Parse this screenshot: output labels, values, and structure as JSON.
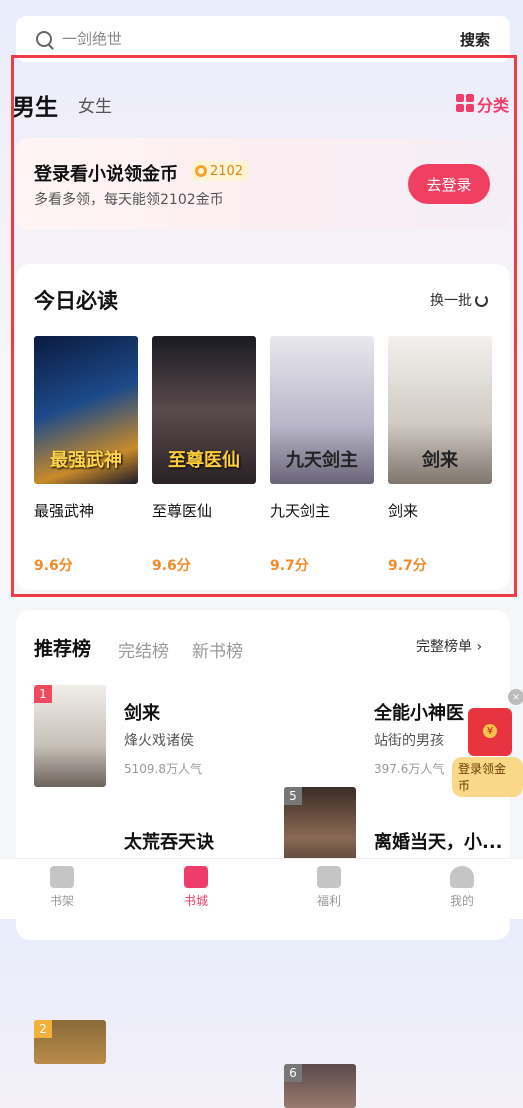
{
  "search": {
    "placeholder": "一剑绝世",
    "button": "搜索"
  },
  "gender_tabs": {
    "male": "男生",
    "female": "女生"
  },
  "category": {
    "label": "分类",
    "icon": "grid-icon",
    "color": "#ee3d6b"
  },
  "login_card": {
    "title": "登录看小说领金币",
    "coins": "2102",
    "subtitle": "多看多领，每天能领2102金币",
    "button": "去登录"
  },
  "today": {
    "title": "今日必读",
    "refresh": "换一批",
    "books": [
      {
        "name": "最强武神",
        "score": "9.6分",
        "cover_text": "最强武神"
      },
      {
        "name": "至尊医仙",
        "score": "9.6分",
        "cover_text": "至尊医仙"
      },
      {
        "name": "九天剑主",
        "score": "9.7分",
        "cover_text": "九天剑主"
      },
      {
        "name": "剑来",
        "score": "9.7分",
        "cover_text": "剑来"
      }
    ]
  },
  "ranking": {
    "tabs": [
      "推荐榜",
      "完结榜",
      "新书榜"
    ],
    "full_list": "完整榜单 ›",
    "items": [
      {
        "no": "1",
        "title": "剑来",
        "author": "烽火戏诸侯",
        "popularity": "5109.8万人气"
      },
      {
        "no": "5",
        "title": "全能小神医",
        "author": "站街的男孩",
        "popularity": "397.6万人气"
      },
      {
        "no": "2",
        "title": "太荒吞天诀",
        "author": "",
        "popularity": ""
      },
      {
        "no": "6",
        "title": "离婚当天，小...",
        "author": "",
        "popularity": ""
      }
    ]
  },
  "floating": {
    "label": "登录领金币",
    "close": "×"
  },
  "nav": [
    {
      "label": "书架",
      "icon": "bookshelf-icon"
    },
    {
      "label": "书城",
      "icon": "bookstore-icon",
      "active": true
    },
    {
      "label": "福利",
      "icon": "gift-icon"
    },
    {
      "label": "我的",
      "icon": "profile-icon"
    }
  ]
}
